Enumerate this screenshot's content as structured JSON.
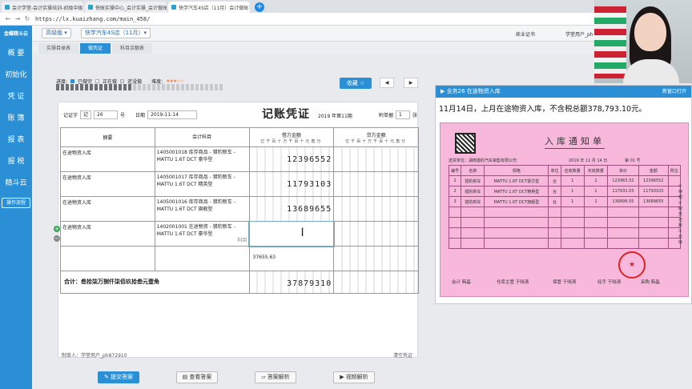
{
  "browser": {
    "tabs": [
      {
        "label": "会计学堂-会计实操培训-初级中级"
      },
      {
        "label": "快账实操中心_会计实操_会计做账"
      },
      {
        "label": "快学汽车4S店（11月）会计做账"
      }
    ],
    "new_tab": "+",
    "url": "https://lx.kuaizhang.com/main_458/"
  },
  "sidebar": {
    "logo": "金蝶精斗云",
    "items": [
      "概 要",
      "初始化",
      "凭 证",
      "账 簿",
      "报 表",
      "报 税",
      "精斗云"
    ],
    "flow_button": "操作流程"
  },
  "appbar": {
    "version_select": "高级版 ▾",
    "company_select": "快学汽车4S店（11月）▾",
    "cert_link": "练业证书",
    "user": "学堂用户_ph"
  },
  "subtabs": [
    "实操目录表",
    "做凭证",
    "科目余额表"
  ],
  "progress": {
    "label": "进度:",
    "done": "已做完",
    "current": "正在做",
    "not_done": "还没做",
    "difficulty_label": "难度:",
    "stars": "★★★☆☆",
    "fraction": 0.45
  },
  "favorite_button": "收藏 ☆",
  "voucher": {
    "type_label": "记证字",
    "type_value": "记",
    "number": "26",
    "number_suffix": "号",
    "date_label": "日期",
    "date": "2019-11-14",
    "title": "记账凭证",
    "period": "2019 年第11期",
    "attach_label": "附单据",
    "attach_count": "1",
    "attach_unit": "张",
    "headers": {
      "summary": "摘要",
      "account": "会计科目",
      "debit": "借方金额",
      "credit": "贷方金额",
      "units": "亿千百十万千百十元角分"
    },
    "rows": [
      {
        "summary": "在途物资入库",
        "account": "1405001018 库存商品 - 猎豹新车 - MATTU 1.6T DCT 豪华型",
        "debit": "12396552"
      },
      {
        "summary": "在途物资入库",
        "account": "1405001017 库存商品 - 猎豹新车 - MATTU 1.6T DCT 精英型",
        "debit": "11793103"
      },
      {
        "summary": "在途物资入库",
        "account": "1405001016 库存商品 - 猎豹新车 - MATTU 1.6T DCT 旗舰型",
        "debit": "13689655"
      },
      {
        "summary": "在途物资入库",
        "account": "1402001001 在途物资 - 猎豹新车 - MATTU 1.6T DCT 豪华型",
        "debit": "",
        "hint": "科目"
      },
      {
        "summary": "",
        "account": "",
        "debit": "",
        "hint_value": "37655.63"
      }
    ],
    "total_label": "合计：叁拾柒万捌仟柒佰玖拾叁元壹角",
    "total_debit": "37879310",
    "maker": "制单人：学堂用户_ph872910",
    "clear": "清空凭证"
  },
  "buttons": {
    "submit": "提交答案",
    "view_answer": "查看答案",
    "analysis": "答案解析",
    "video": "视频解析"
  },
  "task": {
    "header": "业务26 在途物资入库",
    "open_link": "新窗口打开",
    "text": "11月14日，上月在途物资入库，不含税总额378,793.10元。"
  },
  "receipt": {
    "title": "入库通知单",
    "unit_label": "送货单位",
    "unit_value": "湖南猎豹汽车销售有限公司",
    "date": "2019 年 11 月 14 日",
    "no_label": "第 01 号",
    "headers": [
      "编号",
      "名称",
      "规格",
      "单位",
      "应收数量",
      "实收数量",
      "单价",
      "金额",
      "附注"
    ],
    "rows": [
      {
        "no": "1",
        "name": "猎豹新车",
        "spec": "MATTU 1.6T DCT豪华型",
        "unit": "台",
        "qty1": "1",
        "qty2": "1",
        "price": "123965.52",
        "amount": "12396552"
      },
      {
        "no": "2",
        "name": "猎豹新车",
        "spec": "MATTU 1.6T DCT精英型",
        "unit": "台",
        "qty1": "1",
        "qty2": "1",
        "price": "117931.03",
        "amount": "11793103"
      },
      {
        "no": "3",
        "name": "猎豹新车",
        "spec": "MATTU 1.6T DCT旗舰型",
        "unit": "台",
        "qty1": "1",
        "qty2": "1",
        "price": "136896.55",
        "amount": "13689655"
      }
    ],
    "footer": [
      "会计 韩晶",
      "仓库主管 于晓清",
      "保管 于晓清",
      "经手 于晓清",
      "采购 韩晶"
    ],
    "side_notes": "①存根 ②财务记账 ③仓库"
  }
}
